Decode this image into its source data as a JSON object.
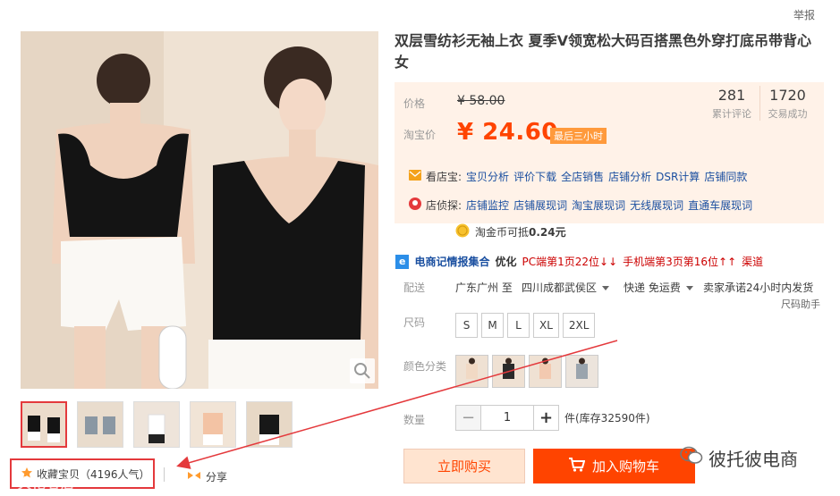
{
  "report_label": "举报",
  "product": {
    "title": "双层雪纺衫无袖上衣 夏季V领宽松大码百搭黑色外穿打底吊带背心女"
  },
  "price": {
    "original_label": "价格",
    "original_value": "¥ 58.00",
    "sale_label": "淘宝价",
    "sale_value": "¥ 24.60",
    "promo_tag": "最后三小时"
  },
  "stats": [
    {
      "number": "281",
      "label": "累计评论"
    },
    {
      "number": "1720",
      "label": "交易成功"
    }
  ],
  "tools": {
    "shop_treasure_label": "看店宝:",
    "shop_treasure_links": [
      "宝贝分析",
      "评价下载",
      "全店销售",
      "店铺分析",
      "DSR计算",
      "店铺同款"
    ],
    "shop_detective_label": "店侦探:",
    "shop_detective_links": [
      "店铺监控",
      "店铺展现词",
      "淘宝展现词",
      "无线展现词",
      "直通车展现词"
    ]
  },
  "coin": {
    "text": "淘金币可抵",
    "amount": "0.24元"
  },
  "rank": {
    "badge": "e",
    "source": "电商记情报集合",
    "optimize": "优化",
    "pc_text": "PC端第1页22位↓↓",
    "mobile_text": "手机端第3页第16位↑↑",
    "channel": "渠道"
  },
  "shipping": {
    "label": "配送",
    "from": "广东广州 至",
    "to": "四川成都武侯区",
    "method": "快递 免运费",
    "promise": "卖家承诺24小时内发货",
    "size_helper": "尺码助手"
  },
  "sizes": {
    "label": "尺码",
    "options": [
      "S",
      "M",
      "L",
      "XL",
      "2XL"
    ]
  },
  "colors": {
    "label": "颜色分类",
    "options": [
      "#f1d9c4",
      "#2a2a2a",
      "#f3c9b0",
      "#9aa4ad"
    ]
  },
  "quantity": {
    "label": "数量",
    "minus": "−",
    "value": "1",
    "plus": "+",
    "stock": "件(库存32590件)"
  },
  "actions": {
    "buy_now": "立即购买",
    "add_to_cart": "加入购物车"
  },
  "favorite": {
    "label": "收藏宝贝（4196人气）"
  },
  "share": {
    "label": "分享"
  },
  "watermarks": {
    "bottom_left": "大佬者店",
    "bottom_right": "彼托彼电商"
  },
  "colors_theme": {
    "accent": "#ff4400",
    "price_bg": "#fff2e8",
    "highlight_box": "#e4393c"
  }
}
